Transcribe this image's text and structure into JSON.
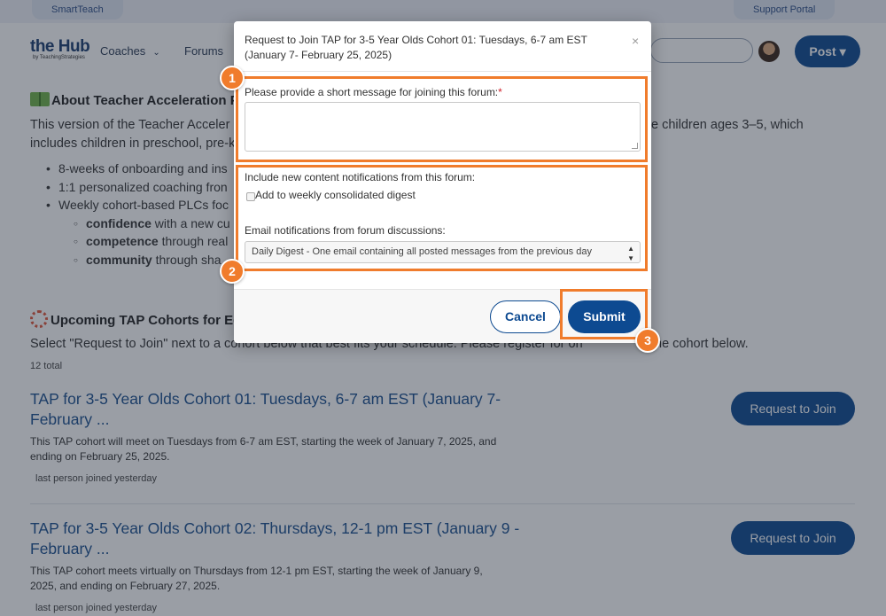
{
  "top_links": {
    "left": "SmartTeach",
    "right": "Support Portal"
  },
  "header": {
    "logo_main": "the Hub",
    "logo_sub": "by TeachingStrategies",
    "nav": [
      {
        "label": "Coaches",
        "icon": "chevron-down-icon"
      },
      {
        "label": "Forums",
        "icon": "chevron-down-icon"
      }
    ],
    "post_label": "Post ▾"
  },
  "about": {
    "heading": "About Teacher Acceleration P",
    "para_line1_a": "This version of the Teacher Acceler",
    "para_line1_b": "e children ages 3–5, which",
    "para_line2": "includes children in preschool, pre-k",
    "bullets": [
      "8-weeks of onboarding and ins",
      "1:1 personalized coaching fron",
      "Weekly cohort-based PLCs foc"
    ],
    "sub_bullets": [
      {
        "bold": "confidence",
        "rest": " with a new cu"
      },
      {
        "bold": "competence",
        "rest": " through real"
      },
      {
        "bold": "community",
        "rest": " through sha"
      }
    ]
  },
  "upcoming": {
    "heading": "Upcoming TAP Cohorts for Ed",
    "instruction_a": "Select \"Request to Join\" next to a cohort below that best fits your schedule. Please register for on",
    "instruction_b": "ne cohort below.",
    "total": "12 total"
  },
  "cohorts": [
    {
      "title": "TAP for 3-5 Year Olds Cohort 01: Tuesdays, 6-7 am EST (January 7- February ...",
      "desc": "This TAP cohort will meet on Tuesdays from 6-7 am EST, starting the week of January 7, 2025, and ending on February 25, 2025.",
      "meta": "last person joined yesterday",
      "button": "Request to Join"
    },
    {
      "title": "TAP for 3-5 Year Olds Cohort 02: Thursdays, 12-1 pm EST (January 9 - February ...",
      "desc": "This TAP cohort meets virtually on Thursdays from 12-1 pm EST, starting the week of January 9, 2025, and ending on February 27, 2025.",
      "meta": "last person joined yesterday",
      "button": "Request to Join"
    }
  ],
  "modal": {
    "title": "Request to Join TAP for 3-5 Year Olds Cohort 01: Tuesdays, 6-7 am EST (January 7- February 25, 2025)",
    "close": "×",
    "message_label": "Please provide a short message for joining this forum:",
    "required_mark": "*",
    "message_value": "",
    "notif_label": "Include new content notifications from this forum:",
    "digest_label": "Add to weekly consolidated digest",
    "digest_checked": false,
    "email_label": "Email notifications from forum discussions:",
    "email_selected": "Daily Digest - One email containing all posted messages from the previous day",
    "cancel": "Cancel",
    "submit": "Submit"
  },
  "annotations": {
    "one": "1",
    "two": "2",
    "three": "3",
    "color": "#f07c2c"
  }
}
